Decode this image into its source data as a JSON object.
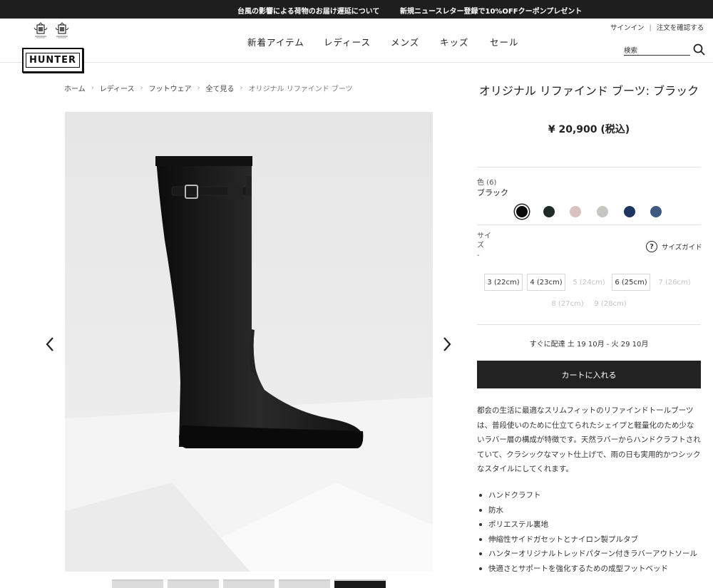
{
  "topbar": {
    "message_1": "台風の影響による荷物のお届け遅延について",
    "message_2": "新規ニュースレター登録で10%OFFクーポンプレゼント"
  },
  "header": {
    "logo": "HUNTER",
    "nav": [
      "新着アイテム",
      "レディース",
      "メンズ",
      "キッズ",
      "セール"
    ],
    "account_signin": "サインイン",
    "account_order": "注文を確認する",
    "account_separator": "|",
    "search_placeholder": "検索"
  },
  "breadcrumb": [
    "ホーム",
    "レディース",
    "フットウェア",
    "全て見る",
    "オリジナル リファインド ブーツ"
  ],
  "product": {
    "title": "オリジナル リファインド ブーツ: ブラック",
    "price": "¥ 20,900 (税込)",
    "color_label": "色 (6)",
    "color_value": "ブラック",
    "swatches": [
      "#0a0a0a",
      "#1f2b27",
      "#d9c2c0",
      "#c8c6c2",
      "#1d3560",
      "#3e5a80"
    ],
    "selected_swatch": 0,
    "size_label": "サイズ",
    "size_value": "-",
    "size_guide": "サイズガイド",
    "sizes": [
      {
        "label": "3 (22cm)",
        "available": true
      },
      {
        "label": "4 (23cm)",
        "available": true
      },
      {
        "label": "5 (24cm)",
        "available": false
      },
      {
        "label": "6 (25cm)",
        "available": true
      },
      {
        "label": "7 (26cm)",
        "available": false
      },
      {
        "label": "8 (27cm)",
        "available": false
      },
      {
        "label": "9 (28cm)",
        "available": false
      }
    ],
    "delivery": "すぐに配達 土 19 10月 - 火 29 10月",
    "cart_button": "カートに入れる",
    "description": "都会の生活に最適なスリムフィットのリファインドトールブーツは、普段使いのために仕立てられたシェイプと軽量化のため少ないラバー層の構成が特徴です。天然ラバーからハンドクラフトされていて、クラシックなマット仕上げで、雨の日も実用的かつシックなスタイルにしてくれます。",
    "features": [
      "ハンドクラフト",
      "防水",
      "ポリエステル裏地",
      "伸縮性サイドガセットとナイロン製プルタブ",
      "ハンターオリジナルトレッドパターン付きラバーアウトソール",
      "快適さとサポートを強化するための成型フットベッド"
    ]
  }
}
